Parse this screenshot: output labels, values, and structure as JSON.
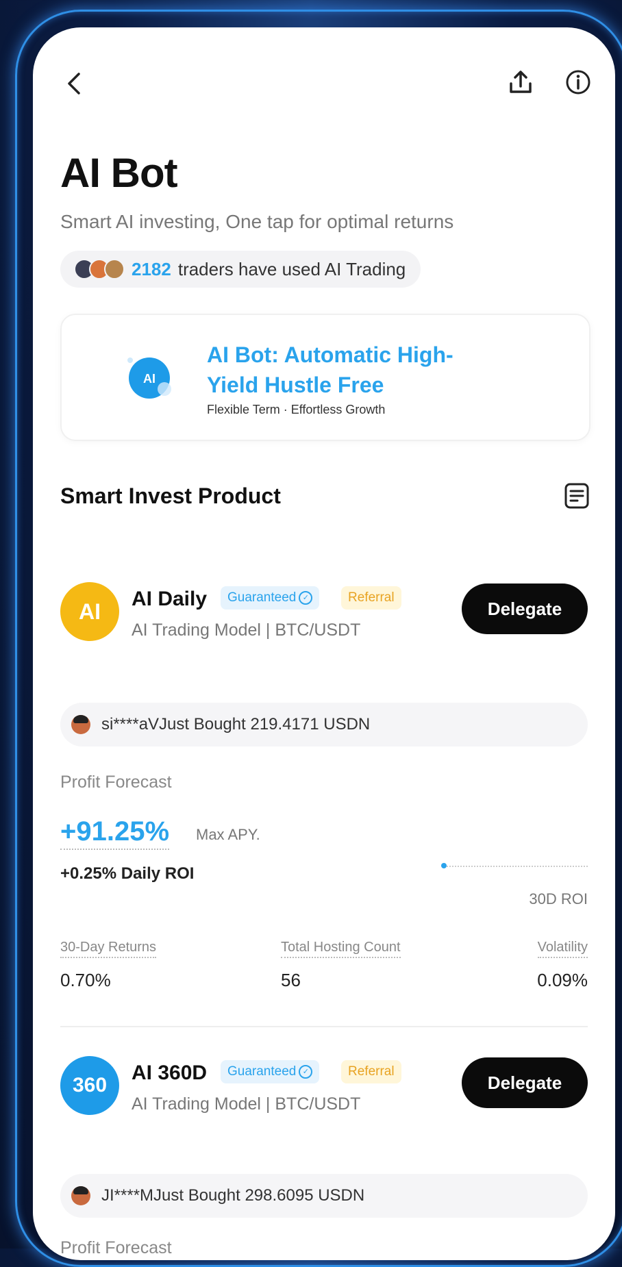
{
  "page": {
    "title": "AI Bot",
    "subtitle": "Smart AI investing, One tap for optimal returns",
    "traders_count": "2182",
    "traders_text": "traders have used AI Trading"
  },
  "promo": {
    "title": "AI Bot: Automatic High-Yield Hustle Free",
    "subtitle": "Flexible Term · Effortless Growth",
    "logo_text": "AI"
  },
  "section": {
    "title": "Smart Invest Product"
  },
  "badges": {
    "guaranteed": "Guaranteed",
    "referral": "Referral"
  },
  "products": [
    {
      "logo_text": "AI",
      "logo_color": "#f5b914",
      "name": "AI Daily",
      "model": "AI Trading Model | BTC/USDT",
      "button": "Delegate",
      "bought": "si****aVJust Bought 219.4171 USDN",
      "profit_forecast_label": "Profit Forecast",
      "apy": "+91.25%",
      "apy_label": "Max APY.",
      "daily_roi": "+0.25% Daily ROI",
      "roi_label": "30D ROI",
      "stats": [
        {
          "label": "30-Day Returns",
          "value": "0.70%"
        },
        {
          "label": "Total Hosting Count",
          "value": "56"
        },
        {
          "label": "Volatility",
          "value": "0.09%"
        }
      ]
    },
    {
      "logo_text": "360",
      "logo_color": "#1e9be8",
      "name": "AI 360D",
      "model": "AI Trading Model | BTC/USDT",
      "button": "Delegate",
      "bought": "JI****MJust Bought 298.6095 USDN",
      "profit_forecast_label": "Profit Forecast"
    }
  ],
  "icons": {
    "back": "chevron-left-icon",
    "share": "share-icon",
    "info": "info-icon",
    "doc": "document-icon"
  },
  "colors": {
    "accent": "#2aa3ec",
    "button_bg": "#0b0b0b",
    "frame_glow": "#2f8fe6"
  }
}
